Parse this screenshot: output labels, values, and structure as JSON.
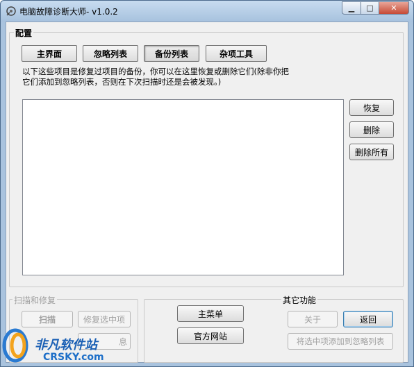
{
  "window": {
    "title": "电脑故障诊断大师- v1.0.2",
    "controls": {
      "minimize": "▁",
      "maximize": "□",
      "close": "✕"
    }
  },
  "config_group": {
    "label": "配置"
  },
  "tabs": [
    {
      "label": "主界面"
    },
    {
      "label": "忽略列表"
    },
    {
      "label": "备份列表",
      "active": true
    },
    {
      "label": "杂项工具"
    }
  ],
  "description": "以下这些项目是修复过项目的备份，你可以在这里恢复或删除它们(除非你把它们添加到忽略列表，否则在下次扫描时还是会被发现。)",
  "backup_list": {
    "items": []
  },
  "side_buttons": {
    "restore": "恢复",
    "delete": "删除",
    "delete_all": "删除所有"
  },
  "scan_group": {
    "label": "扫描和修复",
    "scan": "扫描",
    "repair_selected": "修复选中项",
    "hidden_button_tail": "息"
  },
  "middle_group": {
    "main_menu": "主菜单",
    "official_site": "官方网站"
  },
  "other_group": {
    "label": "其它功能",
    "about": "关于",
    "back": "返回",
    "add_to_ignore": "将选中项添加到忽略列表"
  },
  "watermark": {
    "brand": "非凡软件站",
    "domain": "CRSKY.com"
  }
}
